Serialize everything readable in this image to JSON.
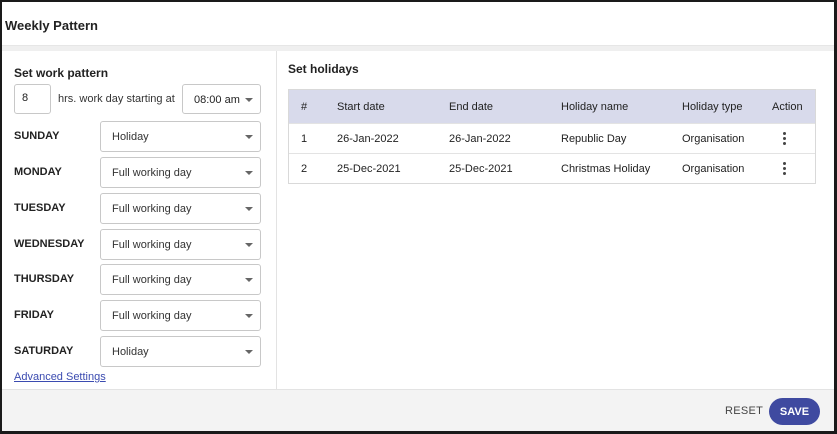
{
  "header": {
    "title": "Weekly Pattern"
  },
  "work_pattern": {
    "title": "Set work pattern",
    "hours_value": "8",
    "hours_label": "hrs. work day starting at",
    "start_time": "08:00 am",
    "days": [
      {
        "label": "SUNDAY",
        "value": "Holiday"
      },
      {
        "label": "MONDAY",
        "value": "Full working day"
      },
      {
        "label": "TUESDAY",
        "value": "Full working day"
      },
      {
        "label": "WEDNESDAY",
        "value": "Full working day"
      },
      {
        "label": "THURSDAY",
        "value": "Full working day"
      },
      {
        "label": "FRIDAY",
        "value": "Full working day"
      },
      {
        "label": "SATURDAY",
        "value": "Holiday"
      }
    ],
    "advanced_link": "Advanced Settings"
  },
  "holidays": {
    "title": "Set holidays",
    "columns": [
      "#",
      "Start date",
      "End date",
      "Holiday name",
      "Holiday type",
      "Action"
    ],
    "rows": [
      {
        "num": "1",
        "start": "26-Jan-2022",
        "end": "26-Jan-2022",
        "name": "Republic Day",
        "type": "Organisation"
      },
      {
        "num": "2",
        "start": "25-Dec-2021",
        "end": "25-Dec-2021",
        "name": "Christmas Holiday",
        "type": "Organisation"
      }
    ]
  },
  "footer": {
    "reset_label": "RESET",
    "save_label": "SAVE"
  },
  "colors": {
    "accent": "#3f4aa0",
    "table_header": "#d8daeb",
    "link": "#3b4bb0"
  }
}
